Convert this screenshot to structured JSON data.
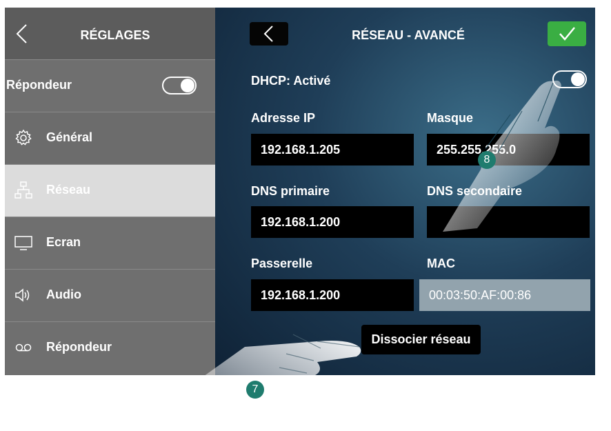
{
  "sidebar": {
    "title": "RÉGLAGES",
    "answering_toggle_label": "Répondeur",
    "answering_toggle_on": true,
    "items": [
      {
        "label": "Général",
        "icon": "gear-icon"
      },
      {
        "label": "Réseau",
        "icon": "network-icon",
        "active": true
      },
      {
        "label": "Ecran",
        "icon": "monitor-icon"
      },
      {
        "label": "Audio",
        "icon": "speaker-icon"
      },
      {
        "label": "Répondeur",
        "icon": "voicemail-icon"
      }
    ]
  },
  "main": {
    "title": "RÉSEAU - AVANCÉ",
    "dhcp_label": "DHCP: Activé",
    "dhcp_on": true,
    "fields": {
      "ip_label": "Adresse IP",
      "ip_value": "192.168.1.205",
      "mask_label": "Masque",
      "mask_value": "255.255.255.0",
      "dns1_label": "DNS primaire",
      "dns1_value": "192.168.1.200",
      "dns2_label": "DNS secondaire",
      "dns2_value": "",
      "gateway_label": "Passerelle",
      "gateway_value": "192.168.1.200",
      "mac_label": "MAC",
      "mac_value": "00:03:50:AF:00:86"
    },
    "dissociate_label": "Dissocier réseau"
  },
  "callouts": {
    "dissociate": "7",
    "dhcp": "8"
  },
  "colors": {
    "accent_green": "#3aae43",
    "callout": "#1f7c6e",
    "sidebar": "#6f6f6f"
  }
}
